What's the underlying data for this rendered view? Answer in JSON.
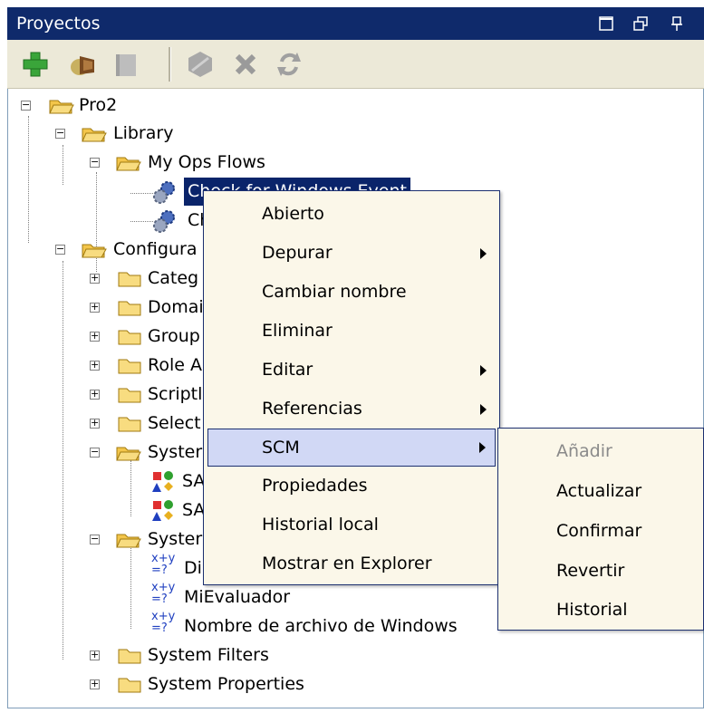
{
  "panel": {
    "title": "Proyectos"
  },
  "toolbar": {
    "icons": [
      "add-icon",
      "open-flow-icon",
      "folder-icon",
      "stop-icon",
      "delete-icon",
      "refresh-icon"
    ]
  },
  "tree": {
    "pro2": "Pro2",
    "library": "Library",
    "my_ops_flows": "My Ops Flows",
    "flow1": "Check for Windows Event",
    "flow2": "Ch",
    "configuration": "Configura",
    "categories": "Categ",
    "domain": "Domai",
    "group": "Group",
    "role": "Role A",
    "scriptlets": "Scriptl",
    "selection": "Select",
    "system1": "Syster",
    "sa1": "SA",
    "sa2": "SA",
    "system2": "Syster",
    "eval1": "Di",
    "eval2": "MiEvaluador",
    "eval3": "Nombre de archivo de Windows",
    "system_filters": "System Filters",
    "system_properties": "System Properties"
  },
  "context_menu": {
    "items": [
      {
        "label": "Abierto"
      },
      {
        "label": "Depurar"
      },
      {
        "label": "Cambiar nombre"
      },
      {
        "label": "Eliminar"
      },
      {
        "label": "Editar"
      },
      {
        "label": "Referencias"
      },
      {
        "label": "SCM"
      },
      {
        "label": "Propiedades"
      },
      {
        "label": "Historial local"
      },
      {
        "label": "Mostrar en Explorer"
      }
    ]
  },
  "submenu": {
    "items": [
      {
        "label": "Añadir",
        "disabled": true
      },
      {
        "label": "Actualizar"
      },
      {
        "label": "Confirmar"
      },
      {
        "label": "Revertir"
      },
      {
        "label": "Historial"
      }
    ]
  },
  "colors": {
    "titlebar": "#0f2a6b",
    "menu_bg": "#fbf7e9",
    "selection": "#d1d8f5",
    "border": "#1b2f70"
  }
}
